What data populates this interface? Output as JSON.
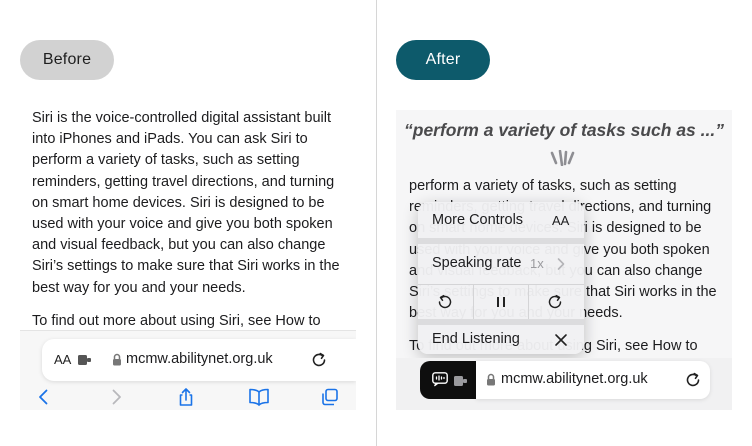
{
  "labels": {
    "before": "Before",
    "after": "After"
  },
  "left": {
    "paragraphs": [
      "Siri is the voice-controlled digital assistant built into iPhones and iPads. You can ask Siri to perform a variety of tasks, such as setting reminders, getting travel directions, and turning on smart home devices. Siri is designed to be used with your voice and give you both spoken and visual feedback, but you can also change Siri’s settings to make sure that Siri works in the best way for you and your needs.",
      "To find out more about using Siri, see How to"
    ],
    "address_bar": {
      "text_size": "AA",
      "url": "mcmw.abilitynet.org.uk"
    },
    "toolbar_icons": [
      "back-icon",
      "forward-icon",
      "share-icon",
      "bookmarks-icon",
      "tabs-icon"
    ]
  },
  "right": {
    "quote": "“perform a variety of tasks such as ...”",
    "paragraphs": [
      "perform a variety of tasks, such as setting reminders, getting travel directions, and turning on smart home devices. Siri is designed to be used with your voice and give you both spoken and visual feedback, but you can also change Siri’s settings to make sure that Siri works in the best way for you and your needs.",
      "To find out more about using Siri, see How to"
    ],
    "menu": {
      "more_controls": "More Controls",
      "more_controls_icon": "AA",
      "speaking_rate": "Speaking rate",
      "speaking_rate_value": "1x",
      "end_listening": "End Listening"
    },
    "address_bar": {
      "url": "mcmw.abilitynet.org.uk"
    }
  },
  "colors": {
    "after_pill": "#0d5a6b",
    "before_pill": "#d2d2d2",
    "ios_blue": "#1a73e8"
  }
}
